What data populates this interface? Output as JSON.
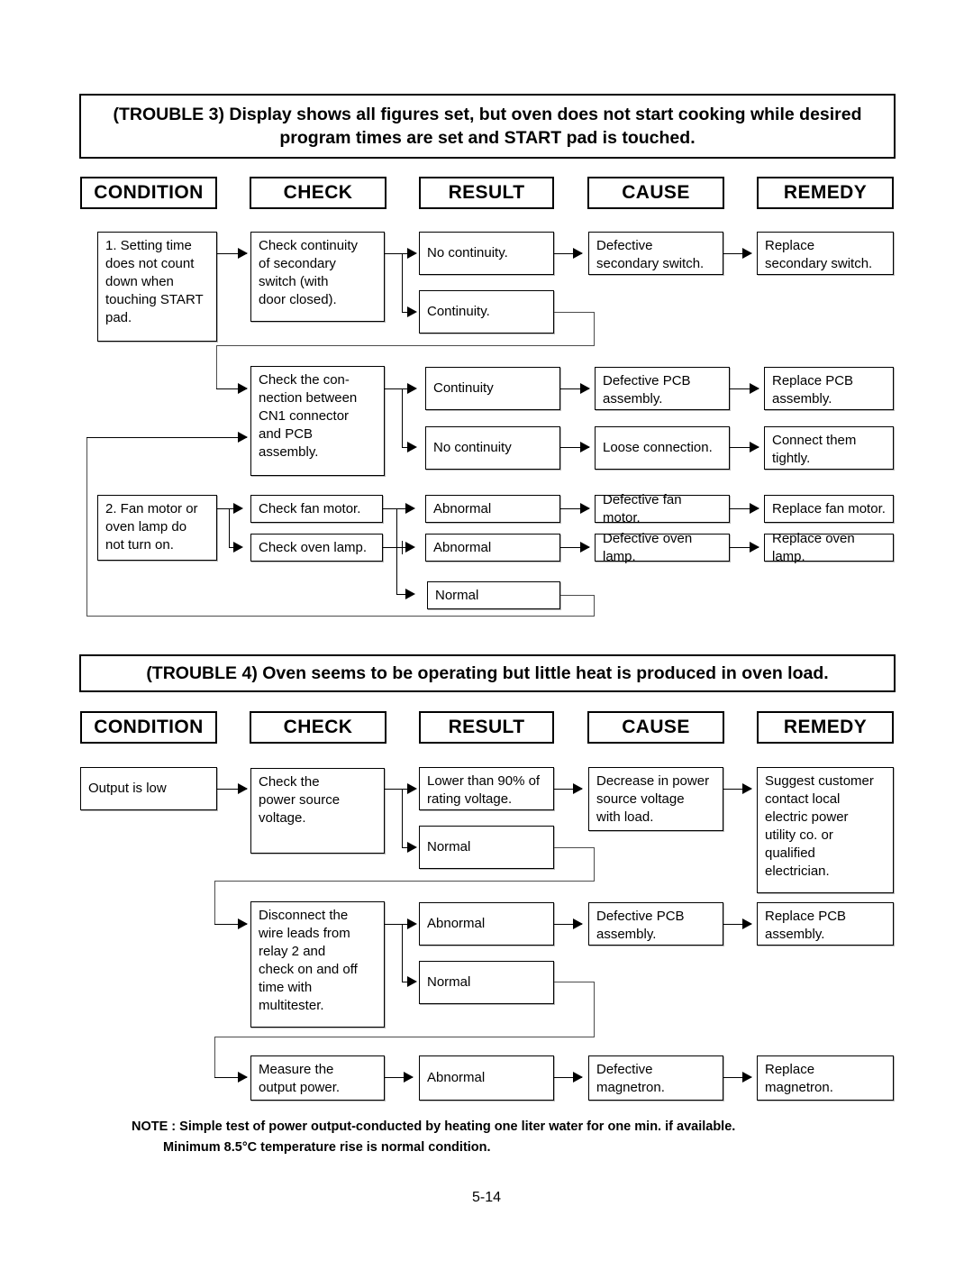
{
  "page": {
    "number": "5-14"
  },
  "columns": [
    "CONDITION",
    "CHECK",
    "RESULT",
    "CAUSE",
    "REMEDY"
  ],
  "trouble3": {
    "title_line1": "(TROUBLE 3) Display shows all figures set, but oven does not start cooking while desired",
    "title_line2": "program times are set and START pad is touched.",
    "condition1": "1. Setting time\n    does not count\n    down when\n    touching START\n    pad.",
    "condition2": "2. Fan motor or\n    oven lamp do\n    not turn on.",
    "check1": "Check continuity\nof secondary\nswitch (with\ndoor closed).",
    "check2": "Check the con-\nnection between\nCN1 connector\nand PCB\nassembly.",
    "check3": "Check fan motor.",
    "check4": "Check oven lamp.",
    "result1": "No continuity.",
    "result2": "Continuity.",
    "result3": "Continuity",
    "result4": "No continuity",
    "result5": "Abnormal",
    "result6": "Abnormal",
    "result7": "Normal",
    "cause1": "Defective\nsecondary switch.",
    "cause2": "Defective PCB\nassembly.",
    "cause3": "Loose  connection.",
    "cause4": "Defective fan motor.",
    "cause5": "Defective oven lamp.",
    "remedy1": "Replace\nsecondary switch.",
    "remedy2": "Replace PCB\nassembly.",
    "remedy3": "Connect them\ntightly.",
    "remedy4": "Replace fan motor.",
    "remedy5": "Replace oven lamp."
  },
  "trouble4": {
    "title_line1": "(TROUBLE 4) Oven seems to be operating but little heat is produced in oven load.",
    "condition1": "Output is low",
    "check1": "Check the\npower source\nvoltage.",
    "check2": "Disconnect the\nwire leads from\nrelay 2 and\ncheck on and off\ntime with\nmultitester.",
    "check3": "Measure the\noutput power.",
    "result1": "Lower than 90% of\nrating voltage.",
    "result2": "Normal",
    "result3": "Abnormal",
    "result4": "Normal",
    "result5": "Abnormal",
    "cause1": "Decrease in power\nsource voltage\nwith load.",
    "cause2": "Defective PCB\nassembly.",
    "cause3": "Defective\nmagnetron.",
    "remedy1": "Suggest customer\ncontact local\nelectric power\nutility co. or\nqualified\nelectrician.",
    "remedy2": "Replace PCB\nassembly.",
    "remedy3": "Replace\nmagnetron."
  },
  "footnote": {
    "line1": "NOTE : Simple test of power output-conducted by heating one liter water for one min. if available.",
    "line2": "Minimum 8.5°C temperature rise is normal condition."
  }
}
